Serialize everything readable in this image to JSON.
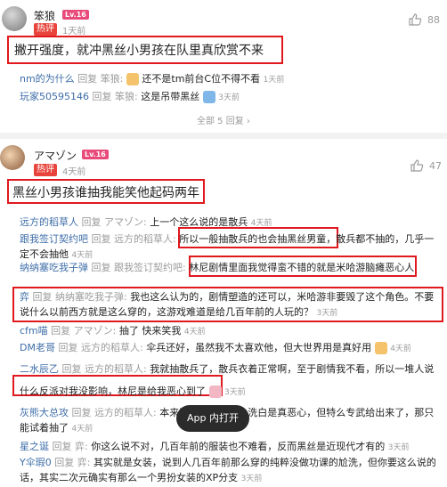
{
  "thread1": {
    "username": "笨狼",
    "level": "Lv.16",
    "badge": "热评",
    "time": "1天前",
    "like_count": "88",
    "comment": "撇开强度，就冲黑丝小男孩在队里真欣赏不来",
    "replies": [
      {
        "user": "nm的为什么",
        "sep": "回复",
        "target": "笨狼:",
        "text": "还不是tm前台C位不得不看",
        "time": "1天前"
      },
      {
        "user": "玩家50595146",
        "sep": "回复",
        "target": "笨狼:",
        "text": "这是吊带黑丝",
        "time": "3天前"
      }
    ],
    "view_all": "全部 5 回复",
    "view_all_icon": "chevron-right"
  },
  "thread2": {
    "username": "アマゾン",
    "level": "Lv.16",
    "badge": "热评",
    "time": "4天前",
    "like_count": "47",
    "comment": "黑丝小男孩谁抽我能笑他起码两年",
    "replies": [
      {
        "user": "远方的稻草人",
        "sep": "回复",
        "target": "アマゾン:",
        "text": "上一个这么说的是散兵",
        "time": "4天前"
      },
      {
        "user": "跟我签订契约吧",
        "sep": "回复",
        "target": "远方的稻草人:",
        "text": "所以一般抽散兵的也会抽黑丝男童，散兵都不抽的，几乎一定不会抽他",
        "time": "4天前"
      },
      {
        "user": "纳纳塞吃我子弹",
        "sep": "回复",
        "target": "跟我签订契约吧:",
        "text": "林尼剧情里面我觉得蛮不错的就是米哈游脑瘫恶心人",
        "time": ""
      },
      {
        "user": "弈",
        "sep": "回复",
        "target": "纳纳塞吃我子弹:",
        "text": "我也这么认为的，剧情塑造的还可以，米哈游非要毁了这个角色。不要说什么以前西方就是这么穿的，这游戏难道是给几百年前的人玩的？",
        "time": "3天前"
      },
      {
        "user": "cfm喵",
        "sep": "回复",
        "target": "アマゾン:",
        "text": "抽了 快来笑我",
        "time": "4天前"
      },
      {
        "user": "DM老哥",
        "sep": "回复",
        "target": "远方的稻草人:",
        "text": "伞兵还好，虽然我不太喜欢他，但大世界用是真好用",
        "time": "4天前"
      },
      {
        "user": "二水辰乙",
        "sep": "回复",
        "target": "远方的稻草人:",
        "text": "我就抽散兵了，散兵衣着正常啊，至于剧情我不看，所以一堆人说什么反派对我没影响，林尼是给我恶心到了",
        "time": "3天前"
      },
      {
        "user": "灰熊大总攻",
        "sep": "回复",
        "target": "远方的稻草人:",
        "text": "本来不想抽散兵的，洗白是真恶心，但特么专武给出来了，那只能试着抽了",
        "time": "4天前"
      },
      {
        "user": "星之诞",
        "sep": "回复",
        "target": "弈:",
        "text": "你这么说不对，几百年前的服装也不难看，反而黑丝是近现代才有的",
        "time": "3天前"
      },
      {
        "user": "Y伞瑕0",
        "sep": "回复",
        "target": "弈:",
        "text": "其实就是女装，说到人几百年前那么穿的纯粹没做功课的尬洗，但你要这么说的话，其实二次元确实有那么一个男扮女装的XP分支",
        "time": "3天前"
      }
    ]
  },
  "app_button": "App 内打开",
  "colors": {
    "highlight": "#e0191f",
    "link_blue": "#3e6ea8",
    "hot_badge": "#e8443b",
    "level_badge": "#e84a7a"
  }
}
